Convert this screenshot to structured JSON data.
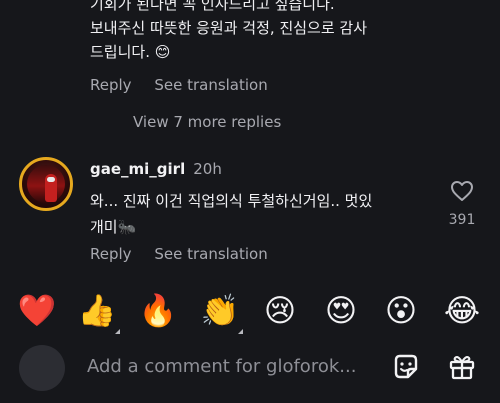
{
  "previous_comment": {
    "lines": [
      "기회가 된다면 꼭 인사드리고 싶습니다.",
      "보내주신 따뜻한 응원과 걱정, 진심으로 감사",
      "드립니다. 😊"
    ],
    "reply_label": "Reply",
    "translate_label": "See translation"
  },
  "view_more": "View 7 more replies",
  "comment": {
    "username": "gae_mi_girl",
    "timestamp": "20h",
    "lines": [
      "와... 진짜 이건 직업의식 투철하신거임.. 멋있",
      "개미🐜"
    ],
    "likes": "391",
    "reply_label": "Reply",
    "translate_label": "See translation"
  },
  "reactions": [
    "❤️",
    "👍",
    "🔥",
    "👏",
    "😢",
    "😍",
    "😮",
    "😂"
  ],
  "composer": {
    "placeholder": "Add a comment for gloforok..."
  }
}
